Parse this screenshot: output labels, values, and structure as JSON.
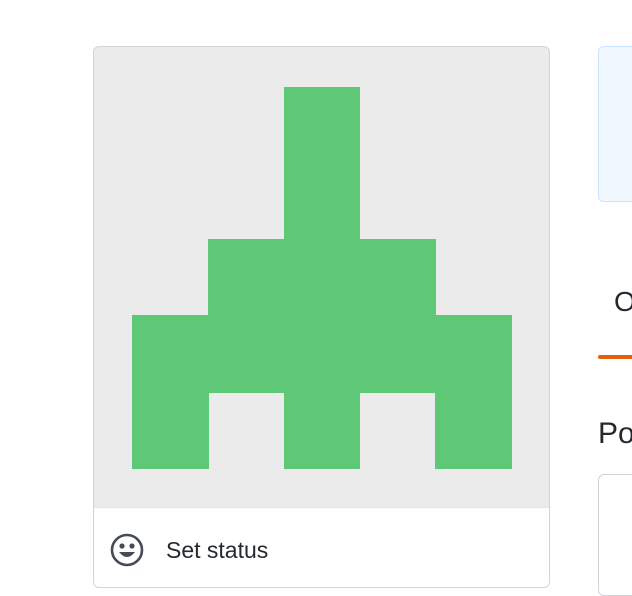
{
  "profile": {
    "avatar": {
      "icon": "identicon",
      "color": "#5ec876",
      "background": "#ebebeb"
    },
    "status": {
      "icon": "smiley-icon",
      "label": "Set status"
    }
  },
  "tabs": [
    {
      "label": "O",
      "selected": true,
      "accent": "#e36209"
    }
  ],
  "section": {
    "heading": "Po"
  }
}
